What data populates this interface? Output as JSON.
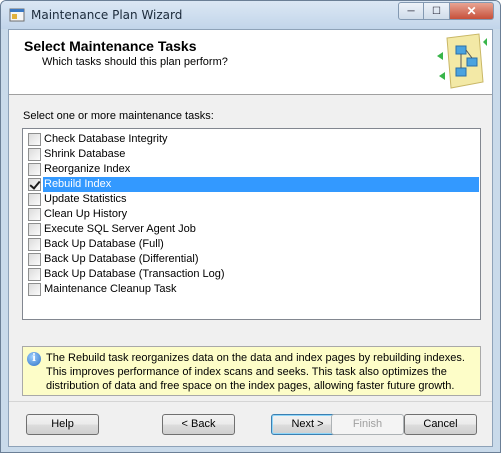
{
  "window": {
    "title": "Maintenance Plan Wizard",
    "caption_minimize": "─",
    "caption_maximize": "☐",
    "caption_close": "✕"
  },
  "header": {
    "title": "Select Maintenance Tasks",
    "subtitle": "Which tasks should this plan perform?",
    "graphic_icon": "wizard-flowchart-icon"
  },
  "task_section": {
    "label": "Select one or more maintenance tasks:",
    "tasks": [
      {
        "label": "Check Database Integrity",
        "checked": false,
        "selected": false
      },
      {
        "label": "Shrink Database",
        "checked": false,
        "selected": false
      },
      {
        "label": "Reorganize Index",
        "checked": false,
        "selected": false
      },
      {
        "label": "Rebuild Index",
        "checked": true,
        "selected": true
      },
      {
        "label": "Update Statistics",
        "checked": false,
        "selected": false
      },
      {
        "label": "Clean Up History",
        "checked": false,
        "selected": false
      },
      {
        "label": "Execute SQL Server Agent Job",
        "checked": false,
        "selected": false
      },
      {
        "label": "Back Up Database (Full)",
        "checked": false,
        "selected": false
      },
      {
        "label": "Back Up Database (Differential)",
        "checked": false,
        "selected": false
      },
      {
        "label": "Back Up Database (Transaction Log)",
        "checked": false,
        "selected": false
      },
      {
        "label": "Maintenance Cleanup Task",
        "checked": false,
        "selected": false
      }
    ]
  },
  "info": {
    "icon": "info-icon",
    "text": "The Rebuild task reorganizes data on the data and index pages by rebuilding indexes. This improves performance of index scans and seeks. This task also optimizes the distribution of data and free space on the index pages, allowing faster future growth."
  },
  "buttons": {
    "help": "Help",
    "back": "< Back",
    "next": "Next >",
    "finish": "Finish",
    "cancel": "Cancel"
  },
  "colors": {
    "selection": "#3399ff",
    "info_background": "#fdfdc8",
    "title_bar": "#c9daea"
  }
}
